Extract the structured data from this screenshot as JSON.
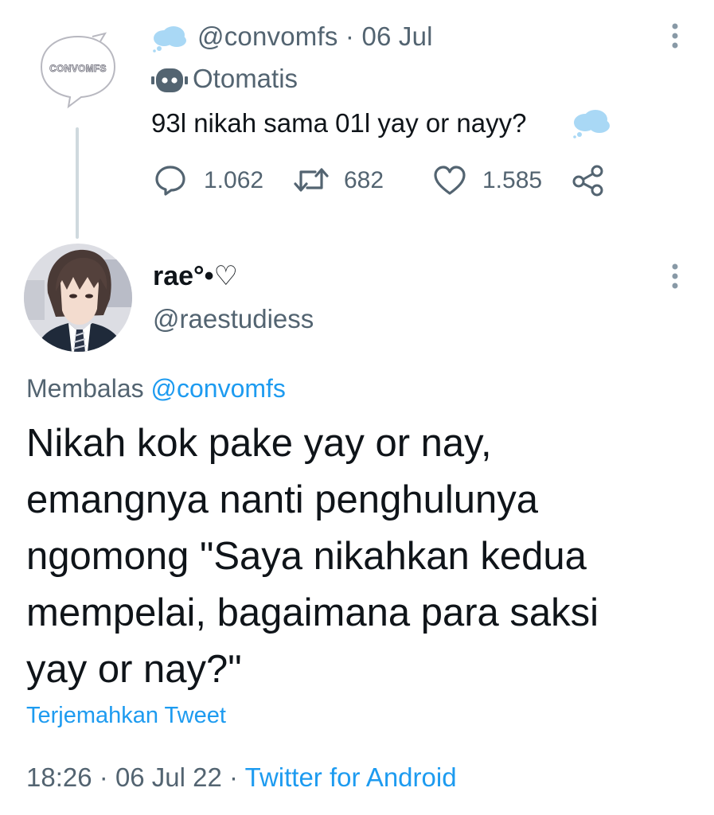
{
  "parent_tweet": {
    "avatar_text": "CONVOMFS",
    "handle_date": "@convomfs · 06 Jul",
    "automated_label": "Otomatis",
    "text": "93l nikah sama 01l yay or nayy?",
    "replies": "1.062",
    "retweets": "682",
    "likes": "1.585"
  },
  "reply_tweet": {
    "display_name": "rae°•♡",
    "handle": "@raestudiess",
    "replying_to_prefix": "Membalas",
    "replying_to_handle": "@convomfs",
    "text_lines": [
      "Nikah kok pake yay or nay,",
      "emangnya nanti penghulunya",
      "ngomong \"Saya nikahkan kedua",
      "mempelai, bagaimana para saksi",
      "yay or nay?\""
    ],
    "translate_label": "Terjemahkan Tweet",
    "time": "18:26",
    "date": "06 Jul 22",
    "source": "Twitter for Android"
  },
  "colors": {
    "accent": "#1d9bf0",
    "secondary_text": "#536471",
    "primary_text": "#0f1419",
    "thread_line": "#cfd9de",
    "cloud": "#a9d8f5"
  },
  "icons": [
    "cloud-icon",
    "robot-icon",
    "reply-icon",
    "retweet-icon",
    "like-icon",
    "share-icon",
    "more-icon"
  ]
}
